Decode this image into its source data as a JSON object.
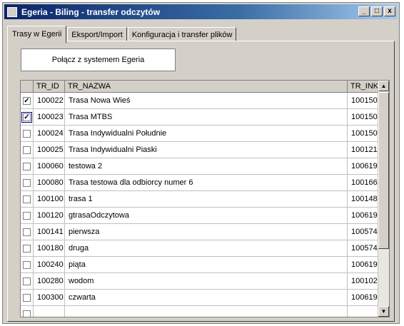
{
  "window": {
    "title": "Egeria - Biling - transfer odczytów",
    "min_glyph": "_",
    "max_glyph": "□",
    "close_glyph": "x"
  },
  "tabs": [
    {
      "label": "Trasy w Egerii",
      "active": true
    },
    {
      "label": "Eksport/Import",
      "active": false
    },
    {
      "label": "Konfiguracja i transfer plików",
      "active": false
    }
  ],
  "connect_button": "Połącz z systemem Egeria",
  "table": {
    "columns": [
      "",
      "TR_ID",
      "TR_NAZWA",
      "TR_INK"
    ],
    "rows": [
      {
        "checked": "✓",
        "id": "100022",
        "name": "Trasa Nowa Wieś",
        "ink": "100150"
      },
      {
        "checked": "✓",
        "id": "100023",
        "name": "Trasa MTBS",
        "ink": "100150"
      },
      {
        "checked": "",
        "id": "100024",
        "name": "Trasa Indywidualni Południe",
        "ink": "100150"
      },
      {
        "checked": "",
        "id": "100025",
        "name": "Trasa Indywidualni Piaski",
        "ink": "100121"
      },
      {
        "checked": "",
        "id": "100060",
        "name": "testowa 2",
        "ink": "100619"
      },
      {
        "checked": "",
        "id": "100080",
        "name": "Trasa testowa dla odbiorcy numer 6",
        "ink": "100166"
      },
      {
        "checked": "",
        "id": "100100",
        "name": "trasa 1",
        "ink": "100148"
      },
      {
        "checked": "",
        "id": "100120",
        "name": "gtrasaOdczytowa",
        "ink": "100619"
      },
      {
        "checked": "",
        "id": "100141",
        "name": "pierwsza",
        "ink": "100574"
      },
      {
        "checked": "",
        "id": "100180",
        "name": "druga",
        "ink": "100574"
      },
      {
        "checked": "",
        "id": "100240",
        "name": "piąta",
        "ink": "100619"
      },
      {
        "checked": "",
        "id": "100280",
        "name": "wodom",
        "ink": "100102"
      },
      {
        "checked": "",
        "id": "100300",
        "name": "czwarta",
        "ink": "100619"
      },
      {
        "checked": "",
        "id": "",
        "name": "",
        "ink": ""
      }
    ]
  },
  "scrollbar": {
    "up_glyph": "▲",
    "down_glyph": "▼"
  }
}
